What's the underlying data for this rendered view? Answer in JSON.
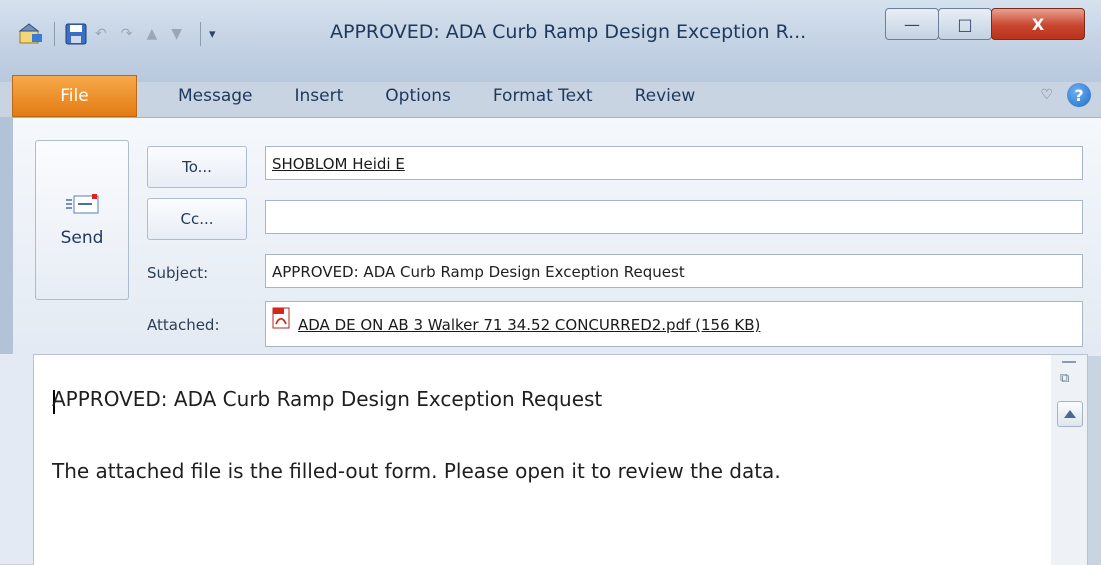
{
  "window": {
    "title": "APPROVED: ADA Curb Ramp Design Exception R...",
    "minimize_label": "—",
    "maximize_label": "□",
    "close_label": "X"
  },
  "quick_access": {
    "undo_icon": "undo-icon",
    "redo_icon": "redo-icon"
  },
  "ribbon": {
    "tabs": [
      "File",
      "Message",
      "Insert",
      "Options",
      "Format Text",
      "Review"
    ],
    "help_label": "?",
    "collapse_icon": "♡"
  },
  "header": {
    "send_label": "Send",
    "to_button": "To...",
    "cc_button": "Cc...",
    "to_value": "SHOBLOM Heidi E",
    "cc_value": "",
    "subject_label": "Subject:",
    "subject_value": "APPROVED: ADA Curb Ramp Design Exception Request",
    "attached_label": "Attached:",
    "attachment": "ADA DE ON AB 3 Walker 71 34.52  CONCURRED2.pdf (156 KB)"
  },
  "body": {
    "line1": "APPROVED: ADA Curb Ramp Design Exception Request",
    "line2": "The attached file is the filled-out form. Please open it to review the data."
  },
  "colors": {
    "file_tab": "#e37b14",
    "title_text": "#1e395b",
    "close_button": "#c8462e"
  }
}
